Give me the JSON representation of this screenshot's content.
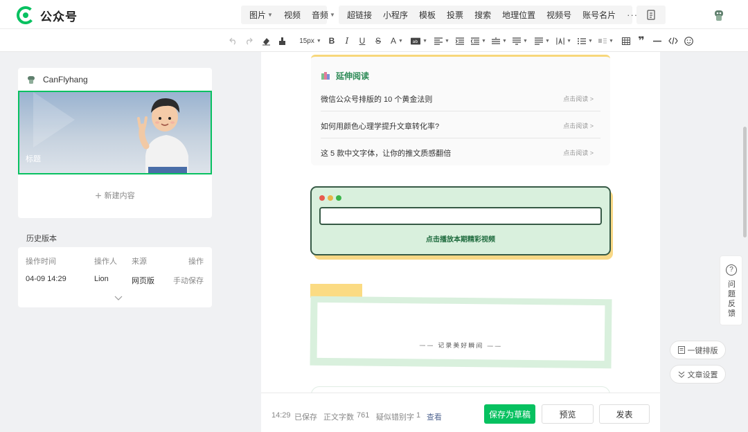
{
  "app": {
    "title": "公众号"
  },
  "insert_menu": {
    "group1": [
      {
        "label": "图片",
        "dropdown": true
      },
      {
        "label": "视频",
        "dropdown": false
      },
      {
        "label": "音频",
        "dropdown": true
      }
    ],
    "group2": [
      "超链接",
      "小程序",
      "模板",
      "投票",
      "搜索",
      "地理位置",
      "视频号",
      "账号名片"
    ],
    "more": "···"
  },
  "toolbar": {
    "font_size": "15px"
  },
  "article": {
    "account_name": "CanFlyhang",
    "cover_title": "标题",
    "new_content": "新建内容"
  },
  "history": {
    "title": "历史版本",
    "headers": [
      "操作时间",
      "操作人",
      "来源",
      "操作"
    ],
    "rows": [
      [
        "04-09 14:29",
        "Lion",
        "网页版",
        "手动保存"
      ]
    ]
  },
  "editor": {
    "extended_reading": {
      "title": "延伸阅读",
      "link_label": "点击阅读 >",
      "items": [
        "微信公众号排版的 10 个黄金法则",
        "如何用颜色心理学提升文章转化率?",
        "这 5 款中文字体，让你的推文质感翻倍"
      ]
    },
    "video_label": "点击播放本期精彩视频",
    "frame_text": "—— 记录美好瞬间 ——"
  },
  "status": {
    "saved_time": "14:29",
    "saved_label": "已保存",
    "word_count_label": "正文字数",
    "word_count": "761",
    "typo_label": "疑似错别字",
    "typo_count": "1",
    "check": "查看"
  },
  "actions": {
    "save": "保存为草稿",
    "preview": "预览",
    "publish": "发表"
  },
  "side": {
    "feedback": "问题反馈",
    "auto_layout": "一键排版",
    "article_settings": "文章设置"
  },
  "colors": {
    "brand": "#07c160",
    "accent_yellow": "#f7d77a",
    "card_green": "#d9f0dd",
    "dark_green": "#365945"
  }
}
